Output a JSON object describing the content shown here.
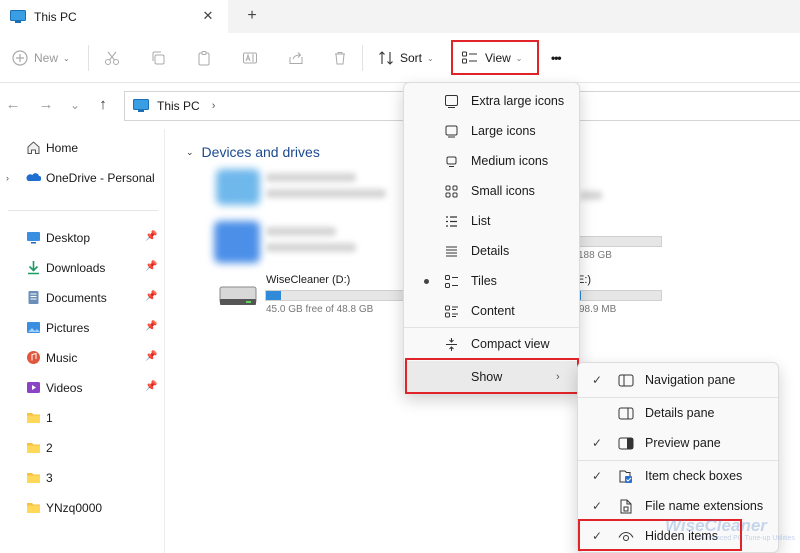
{
  "window": {
    "tab_title": "This PC",
    "tab_close": "✕",
    "tab_add": "+"
  },
  "toolbar": {
    "new_label": "New",
    "sort_label": "Sort",
    "view_label": "View",
    "more_label": "•••"
  },
  "nav": {
    "back": "←",
    "forward": "→",
    "down": "⌄",
    "up": "↑",
    "address": "This PC",
    "address_chevron": "›"
  },
  "sidebar": {
    "items": [
      {
        "label": "Home",
        "icon": "home-icon"
      },
      {
        "label": "OneDrive - Personal",
        "icon": "onedrive-icon"
      },
      {
        "label": "Desktop",
        "icon": "desktop-icon",
        "pinned": true
      },
      {
        "label": "Downloads",
        "icon": "downloads-icon",
        "pinned": true
      },
      {
        "label": "Documents",
        "icon": "documents-icon",
        "pinned": true
      },
      {
        "label": "Pictures",
        "icon": "pictures-icon",
        "pinned": true
      },
      {
        "label": "Music",
        "icon": "music-icon",
        "pinned": true
      },
      {
        "label": "Videos",
        "icon": "videos-icon",
        "pinned": true
      },
      {
        "label": "1",
        "icon": "folder-icon"
      },
      {
        "label": "2",
        "icon": "folder-icon"
      },
      {
        "label": "3",
        "icon": "folder-icon"
      },
      {
        "label": "YNzq0000",
        "icon": "folder-icon"
      }
    ]
  },
  "content": {
    "section_title": "Devices and drives",
    "drives": [
      {
        "name": "WiseCleaner (D:)",
        "free": "45.0 GB free of 48.8 GB",
        "used_fraction": 0.08
      },
      {
        "name": "E:)",
        "free": "98.9 MB",
        "used_fraction": 0.02
      },
      {
        "name": "",
        "free": "188 GB",
        "used_fraction": 0.0
      }
    ]
  },
  "view_menu": {
    "items": [
      {
        "label": "Extra large icons",
        "icon": "extra-large-icons-icon"
      },
      {
        "label": "Large icons",
        "icon": "large-icons-icon"
      },
      {
        "label": "Medium icons",
        "icon": "medium-icons-icon"
      },
      {
        "label": "Small icons",
        "icon": "small-icons-icon"
      },
      {
        "label": "List",
        "icon": "list-icon"
      },
      {
        "label": "Details",
        "icon": "details-icon"
      },
      {
        "label": "Tiles",
        "icon": "tiles-icon",
        "selected": true
      },
      {
        "label": "Content",
        "icon": "content-icon"
      },
      {
        "label": "Compact view",
        "icon": "compact-view-icon"
      },
      {
        "label": "Show",
        "arrow": "›"
      }
    ]
  },
  "show_menu": {
    "items": [
      {
        "label": "Navigation pane",
        "checked": true
      },
      {
        "label": "Details pane",
        "checked": false
      },
      {
        "label": "Preview pane",
        "checked": true
      },
      {
        "label": "Item check boxes",
        "checked": true
      },
      {
        "label": "File name extensions",
        "checked": true
      },
      {
        "label": "Hidden items",
        "checked": true
      }
    ],
    "check_glyph": "✓"
  },
  "watermark": {
    "text": "WiseCleaner",
    "sub": "Advanced PC Tune-up Utilities"
  },
  "colors": {
    "accent": "#2f8bd7",
    "highlight_box": "#e0242a",
    "section_title": "#1c4a8f"
  }
}
